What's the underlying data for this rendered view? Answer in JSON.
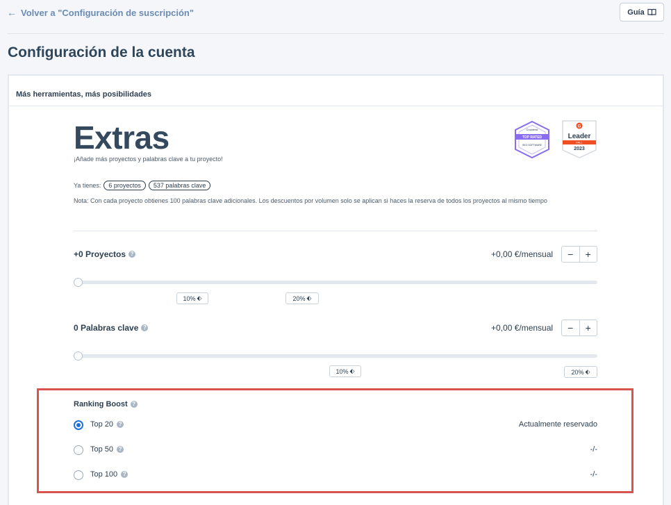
{
  "nav": {
    "back_label": "Volver a \"Configuración de suscripción\"",
    "guide_label": "Guía"
  },
  "page": {
    "title": "Configuración de la cuenta"
  },
  "panel": {
    "header": "Más herramientas, más posibilidades"
  },
  "extras": {
    "title": "Extras",
    "subtitle": "¡Añade más proyectos y palabras clave a tu proyecto!",
    "have_label": "Ya tienes:",
    "have_projects": "6 proyectos",
    "have_keywords": "537 palabras clave",
    "note": "Nota: Con cada proyecto obtienes 100 palabras clave adicionales. Los descuentos por volumen solo se aplican si haces la reserva de todos los proyectos al mismo tiempo"
  },
  "badges": {
    "g2": {
      "line1": "TOP RATED",
      "line2": "SEO SOFTWARE",
      "brand": "Crozdesk"
    },
    "leader": {
      "title": "Leader",
      "season": "FALL",
      "year": "2023",
      "brand": "G",
      "accent": "#f04e23"
    }
  },
  "projects": {
    "label": "+0 Proyectos",
    "price": "+0,00 €/mensual",
    "slider_value": 0,
    "ticks": [
      "10%",
      "20%"
    ]
  },
  "keywords": {
    "label": "0 Palabras clave",
    "price": "+0,00 €/mensual",
    "slider_value": 0,
    "ticks": [
      "10%",
      "20%"
    ]
  },
  "stepper": {
    "minus": "−",
    "plus": "+"
  },
  "ranking_boost": {
    "title": "Ranking Boost",
    "options": [
      {
        "label": "Top 20",
        "status": "Actualmente reservado",
        "selected": true
      },
      {
        "label": "Top 50",
        "status": "-/-",
        "selected": false
      },
      {
        "label": "Top 100",
        "status": "-/-",
        "selected": false
      }
    ]
  },
  "colors": {
    "accent": "#1e6fd9",
    "highlight": "#d9534f",
    "title": "#2f4559"
  }
}
